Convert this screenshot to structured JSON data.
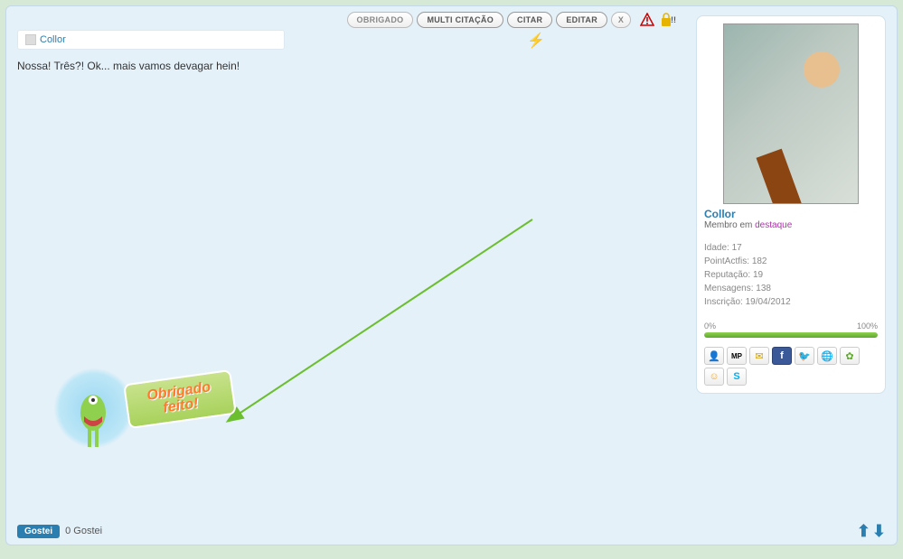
{
  "actions": {
    "obrigado": "OBRIGADO",
    "multi_citacao": "MULTI CITAÇÃO",
    "citar": "CITAR",
    "editar": "EDITAR",
    "close": "X"
  },
  "quote": {
    "author": "Collor"
  },
  "post": {
    "text": "Nossa! Três?! Ok... mais vamos devagar hein!"
  },
  "user": {
    "name": "Collor",
    "title_prefix": "Membro em ",
    "title_highlight": "destaque",
    "stats": {
      "idade_label": "Idade: ",
      "idade": "17",
      "points_label": "PointActfis: ",
      "points": "182",
      "rep_label": "Reputação: ",
      "rep": "19",
      "msg_label": "Mensagens: ",
      "msg": "138",
      "insc_label": "Inscrição: ",
      "insc": "19/04/2012"
    },
    "progress": {
      "min": "0%",
      "max": "100%"
    }
  },
  "badge": {
    "line1": "Obrigado",
    "line2": "feito!"
  },
  "footer": {
    "like_button": "Gostei",
    "like_count": "0 Gostei"
  }
}
